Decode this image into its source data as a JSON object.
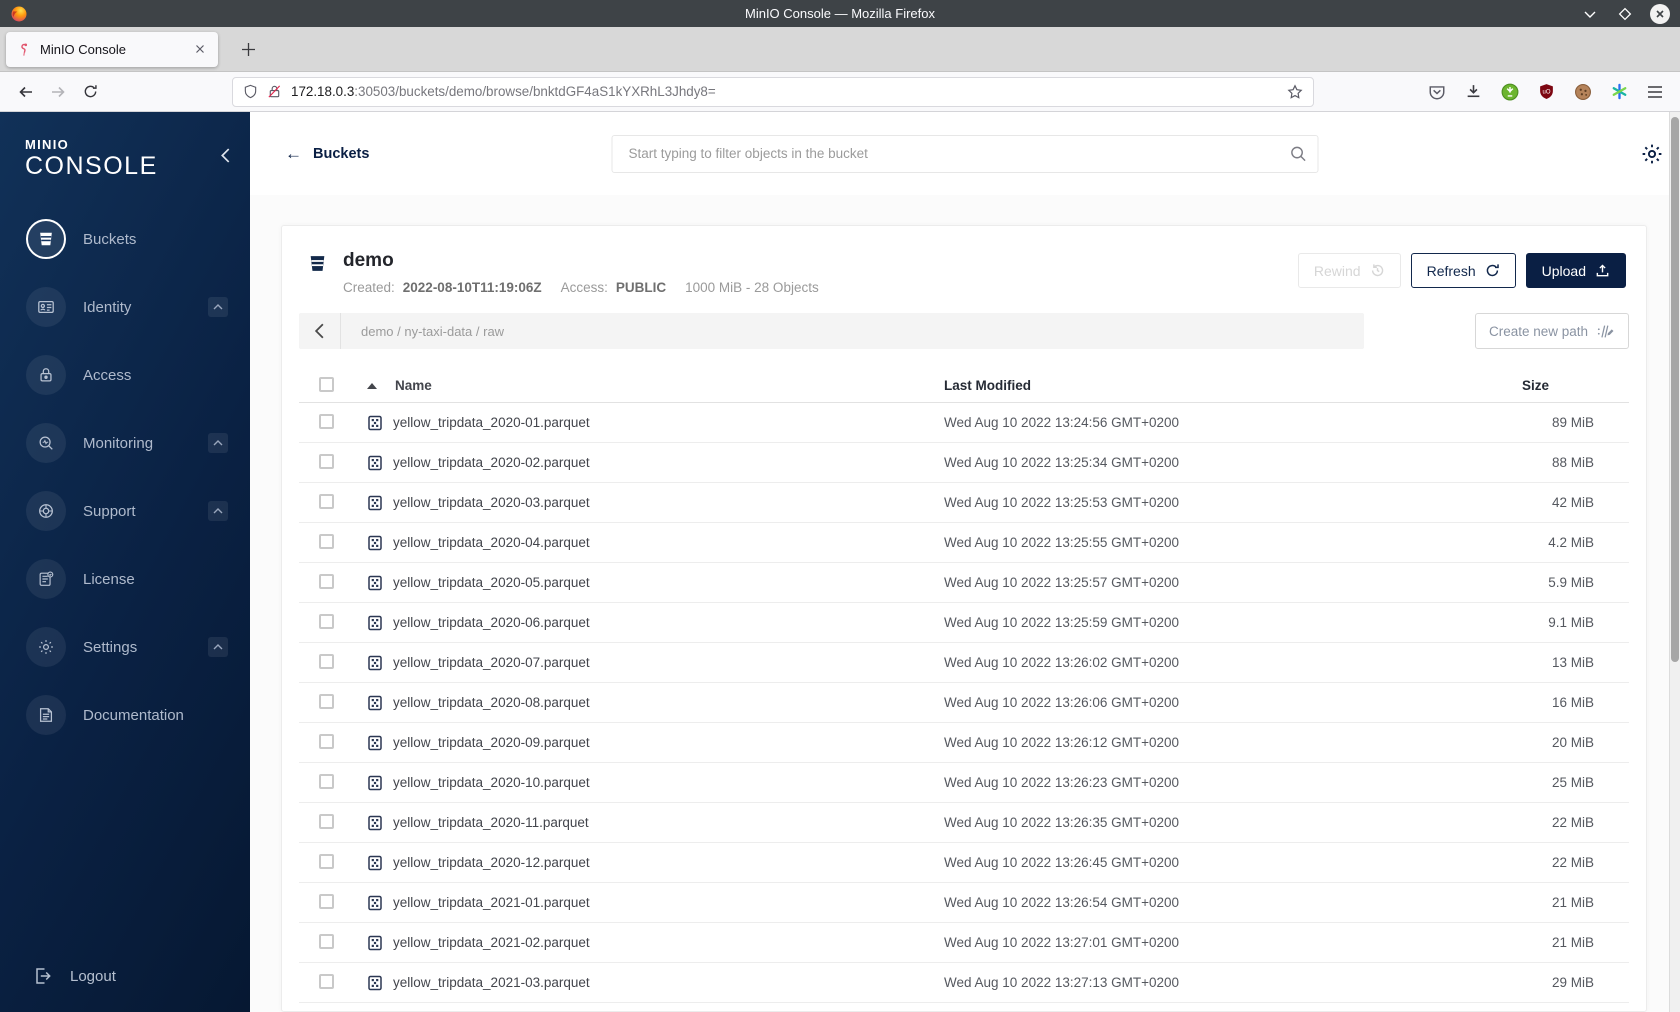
{
  "window": {
    "title": "MinIO Console — Mozilla Firefox",
    "controls": [
      "minimize",
      "maximize",
      "close"
    ]
  },
  "browser": {
    "tab_title": "MinIO Console",
    "url_host": "172.18.0.3",
    "url_rest": ":30503/buckets/demo/browse/bnktdGF4aS1kYXRhL3Jhdy8=",
    "toolbar_icons": [
      "shield",
      "lock-disabled",
      "bookmark-star",
      "pocket",
      "download",
      "extension-green",
      "ublock-shield",
      "cookie",
      "container-asterisk",
      "menu"
    ]
  },
  "sidebar": {
    "logo_top": "MINIO",
    "logo_bottom": "CONSOLE",
    "items": [
      {
        "label": "Buckets",
        "icon": "bucket-icon",
        "active": true
      },
      {
        "label": "Identity",
        "icon": "identity-card-icon",
        "expandable": true
      },
      {
        "label": "Access",
        "icon": "lock-icon"
      },
      {
        "label": "Monitoring",
        "icon": "monitor-search-icon",
        "expandable": true
      },
      {
        "label": "Support",
        "icon": "lifering-icon",
        "expandable": true
      },
      {
        "label": "License",
        "icon": "license-doc-icon"
      },
      {
        "label": "Settings",
        "icon": "gear-icon",
        "expandable": true
      },
      {
        "label": "Documentation",
        "icon": "document-icon"
      }
    ],
    "logout_label": "Logout"
  },
  "header": {
    "back_label": "Buckets",
    "search_placeholder": "Start typing to filter objects in the bucket"
  },
  "bucket": {
    "name": "demo",
    "created_label": "Created:",
    "created": "2022-08-10T11:19:06Z",
    "access_label": "Access:",
    "access": "PUBLIC",
    "summary": "1000 MiB - 28 Objects",
    "rewind_label": "Rewind",
    "refresh_label": "Refresh",
    "upload_label": "Upload"
  },
  "browse": {
    "path": "demo / ny-taxi-data / raw",
    "create_path_label": "Create new path"
  },
  "table": {
    "col_name": "Name",
    "col_modified": "Last Modified",
    "col_size": "Size",
    "rows": [
      {
        "name": "yellow_tripdata_2020-01.parquet",
        "modified": "Wed Aug 10 2022 13:24:56 GMT+0200",
        "size": "89 MiB"
      },
      {
        "name": "yellow_tripdata_2020-02.parquet",
        "modified": "Wed Aug 10 2022 13:25:34 GMT+0200",
        "size": "88 MiB"
      },
      {
        "name": "yellow_tripdata_2020-03.parquet",
        "modified": "Wed Aug 10 2022 13:25:53 GMT+0200",
        "size": "42 MiB"
      },
      {
        "name": "yellow_tripdata_2020-04.parquet",
        "modified": "Wed Aug 10 2022 13:25:55 GMT+0200",
        "size": "4.2 MiB"
      },
      {
        "name": "yellow_tripdata_2020-05.parquet",
        "modified": "Wed Aug 10 2022 13:25:57 GMT+0200",
        "size": "5.9 MiB"
      },
      {
        "name": "yellow_tripdata_2020-06.parquet",
        "modified": "Wed Aug 10 2022 13:25:59 GMT+0200",
        "size": "9.1 MiB"
      },
      {
        "name": "yellow_tripdata_2020-07.parquet",
        "modified": "Wed Aug 10 2022 13:26:02 GMT+0200",
        "size": "13 MiB"
      },
      {
        "name": "yellow_tripdata_2020-08.parquet",
        "modified": "Wed Aug 10 2022 13:26:06 GMT+0200",
        "size": "16 MiB"
      },
      {
        "name": "yellow_tripdata_2020-09.parquet",
        "modified": "Wed Aug 10 2022 13:26:12 GMT+0200",
        "size": "20 MiB"
      },
      {
        "name": "yellow_tripdata_2020-10.parquet",
        "modified": "Wed Aug 10 2022 13:26:23 GMT+0200",
        "size": "25 MiB"
      },
      {
        "name": "yellow_tripdata_2020-11.parquet",
        "modified": "Wed Aug 10 2022 13:26:35 GMT+0200",
        "size": "22 MiB"
      },
      {
        "name": "yellow_tripdata_2020-12.parquet",
        "modified": "Wed Aug 10 2022 13:26:45 GMT+0200",
        "size": "22 MiB"
      },
      {
        "name": "yellow_tripdata_2021-01.parquet",
        "modified": "Wed Aug 10 2022 13:26:54 GMT+0200",
        "size": "21 MiB"
      },
      {
        "name": "yellow_tripdata_2021-02.parquet",
        "modified": "Wed Aug 10 2022 13:27:01 GMT+0200",
        "size": "21 MiB"
      },
      {
        "name": "yellow_tripdata_2021-03.parquet",
        "modified": "Wed Aug 10 2022 13:27:13 GMT+0200",
        "size": "29 MiB"
      }
    ]
  },
  "colors": {
    "accent_navy": "#0A1F44",
    "sidebar_gradient_start": "#113158",
    "sidebar_gradient_end": "#061832",
    "titlebar": "#3E4347",
    "breadcrumb_bg": "#F4F4F4",
    "disabled_text": "#D6D6D6"
  }
}
